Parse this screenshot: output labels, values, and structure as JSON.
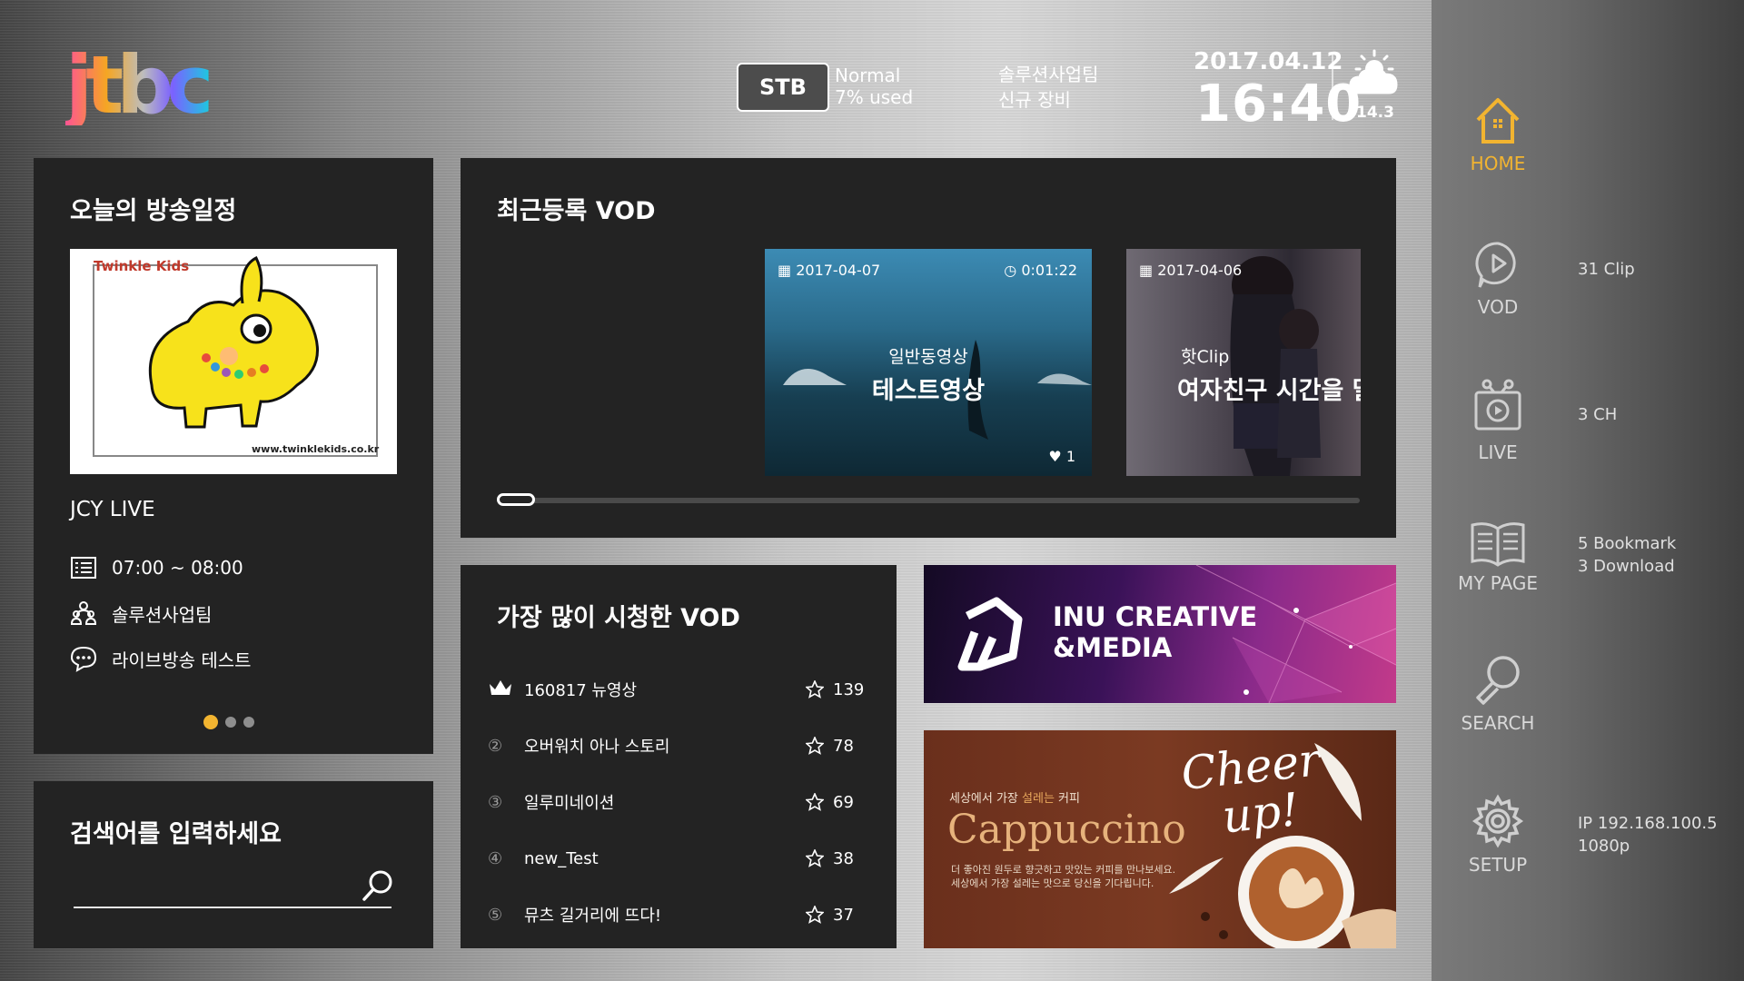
{
  "header": {
    "logo_text": "jtbc",
    "stb_label": "STB",
    "stb_status": [
      "Normal",
      "7% used"
    ],
    "team": [
      "솔루션사업팀",
      "신규 장비"
    ],
    "date": "2017.04.12",
    "time": "16:40",
    "temperature": "14.3"
  },
  "sidebar": {
    "items": [
      {
        "label": "HOME",
        "icon": "home-icon",
        "info": []
      },
      {
        "label": "VOD",
        "icon": "vod-play-icon",
        "info": [
          "31 Clip"
        ]
      },
      {
        "label": "LIVE",
        "icon": "tv-live-icon",
        "info": [
          "3 CH"
        ]
      },
      {
        "label": "MY PAGE",
        "icon": "book-icon",
        "info": [
          "5 Bookmark",
          "3 Download"
        ]
      },
      {
        "label": "SEARCH",
        "icon": "magnifier-icon",
        "info": []
      },
      {
        "label": "SETUP",
        "icon": "gear-icon",
        "info": [
          "IP 192.168.100.5",
          "1080p"
        ]
      }
    ]
  },
  "schedule": {
    "title": "오늘의 방송일정",
    "thumb_brand": "Twinkle Kids",
    "thumb_url": "www.twinklekids.co.kr",
    "channel": "JCY LIVE",
    "time": "07:00 ~ 08:00",
    "team": "솔루션사업팀",
    "program": "라이브방송 테스트",
    "pager_count": 3,
    "pager_active": 1
  },
  "recent_vod": {
    "title": "최근등록 VOD",
    "cards": [
      {
        "date": "2017-04-07",
        "duration": "0:01:22",
        "category": "일반동영상",
        "title": "테스트영상",
        "likes": "1"
      },
      {
        "date": "2017-04-06",
        "duration": "",
        "category": "핫Clip",
        "title": "여자친구 시간을 달",
        "likes": ""
      }
    ],
    "scroll_progress": 0.02
  },
  "popular_vod": {
    "title": "가장 많이 시청한 VOD",
    "items": [
      {
        "rank": "crown",
        "name": "160817 뉴영상",
        "score": "139"
      },
      {
        "rank": "②",
        "name": "오버워치 아나 스토리",
        "score": "78"
      },
      {
        "rank": "③",
        "name": "일루미네이션",
        "score": "69"
      },
      {
        "rank": "④",
        "name": "new_Test",
        "score": "38"
      },
      {
        "rank": "⑤",
        "name": "뮤츠 길거리에 뜨다!",
        "score": "37"
      }
    ]
  },
  "search": {
    "title": "검색어를 입력하세요",
    "placeholder": ""
  },
  "banners": {
    "inu": {
      "line1": "INU CREATIVE",
      "line2": "&MEDIA"
    },
    "coffee": {
      "tagline_a": "세상에서 가장 ",
      "tagline_b": "설레는",
      "tagline_c": " 커피",
      "title": "Cappuccino",
      "desc1": "더 좋아진 원두로 향긋하고 맛있는 커피를 만나보세요.",
      "desc2": "세상에서 가장 설레는 맛으로 당신을 기다립니다.",
      "script1": "Cheer",
      "script2": "up!"
    }
  },
  "colors": {
    "accent": "#f2b430",
    "panel": "#232323"
  }
}
